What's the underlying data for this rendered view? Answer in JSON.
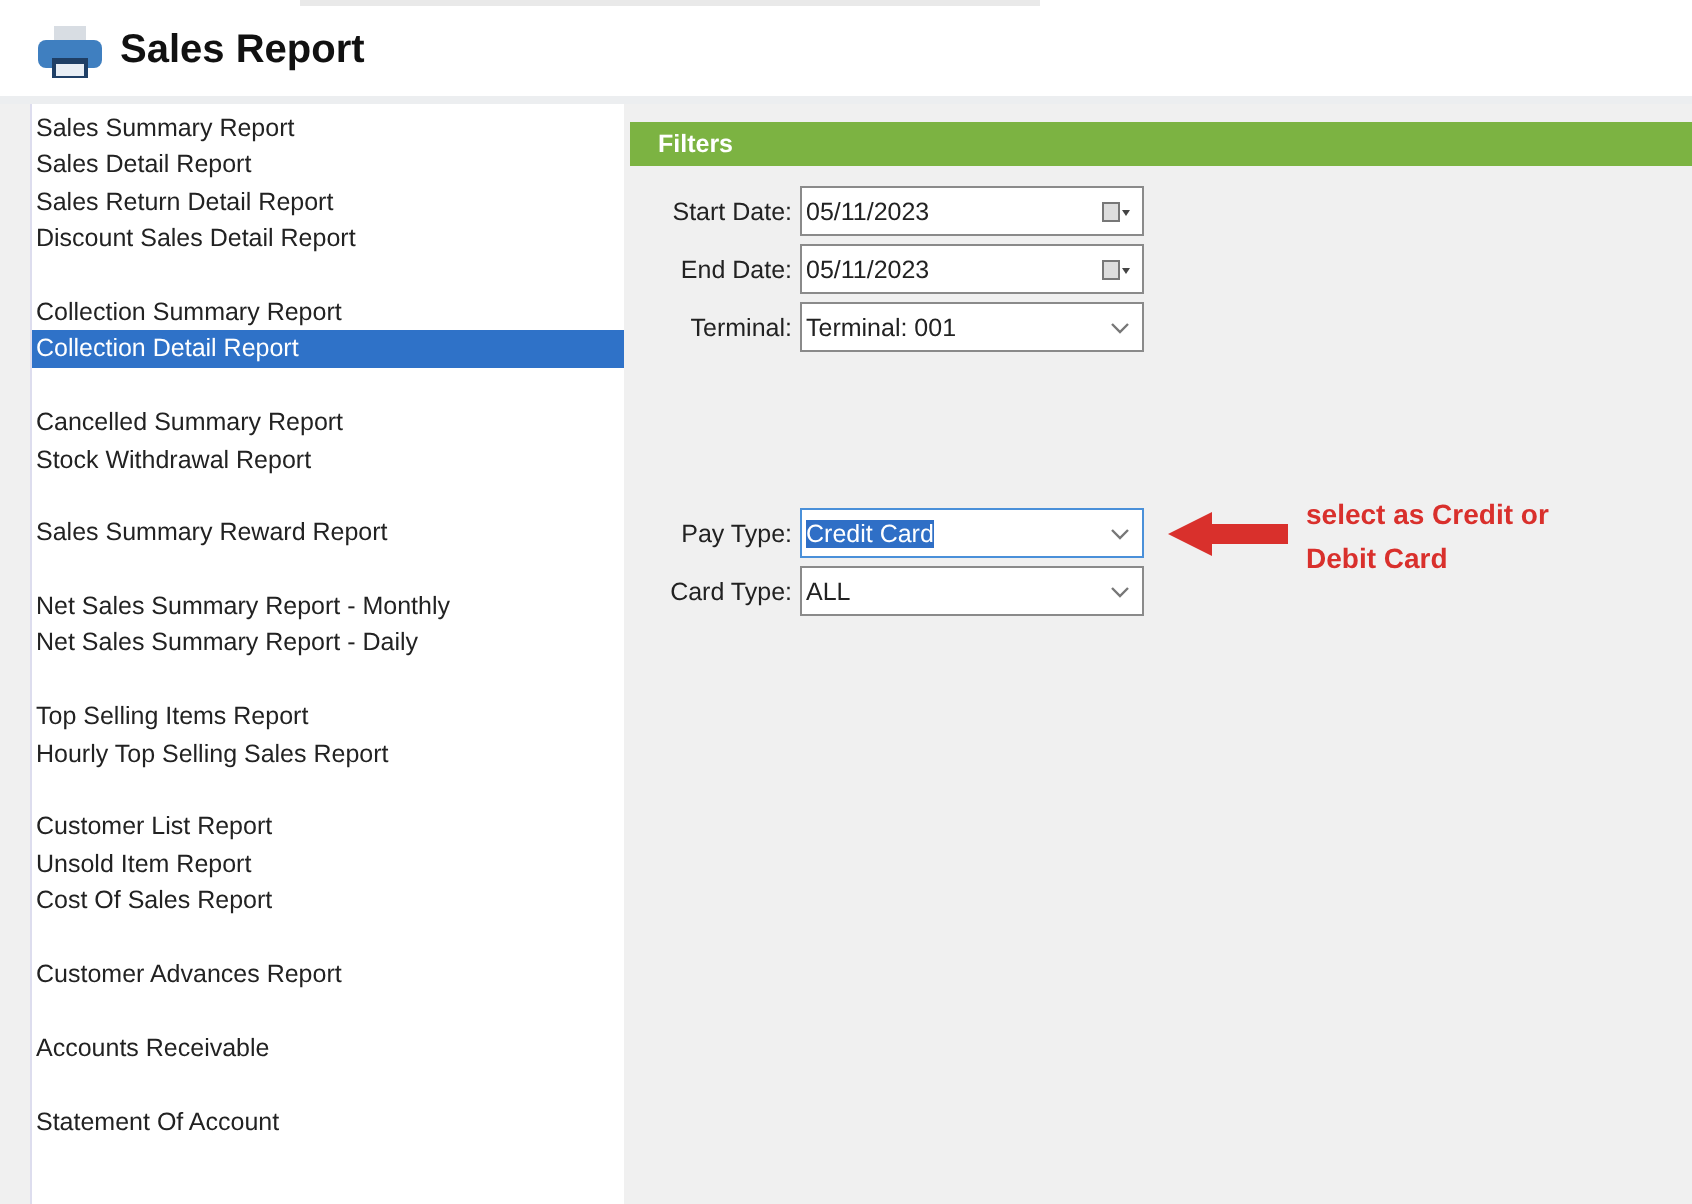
{
  "window": {
    "title": "Sales Report"
  },
  "sidebar": {
    "groups": [
      [
        {
          "label": "Sales Summary Report",
          "selected": false
        },
        {
          "label": "Sales Detail Report",
          "selected": false
        },
        {
          "label": "Sales Return Detail Report",
          "selected": false
        },
        {
          "label": "Discount Sales Detail Report",
          "selected": false
        }
      ],
      [
        {
          "label": "Collection Summary Report",
          "selected": false
        },
        {
          "label": "Collection Detail Report",
          "selected": true
        }
      ],
      [
        {
          "label": "Cancelled Summary Report",
          "selected": false
        },
        {
          "label": "Stock Withdrawal Report",
          "selected": false
        }
      ],
      [
        {
          "label": "Sales Summary Reward Report",
          "selected": false
        }
      ],
      [
        {
          "label": "Net Sales Summary Report - Monthly",
          "selected": false
        },
        {
          "label": "Net Sales Summary Report - Daily",
          "selected": false
        }
      ],
      [
        {
          "label": "Top Selling Items Report",
          "selected": false
        },
        {
          "label": "Hourly Top Selling Sales Report",
          "selected": false
        }
      ],
      [
        {
          "label": "Customer List Report",
          "selected": false
        },
        {
          "label": "Unsold Item Report",
          "selected": false
        },
        {
          "label": "Cost Of Sales Report",
          "selected": false
        }
      ],
      [
        {
          "label": "Customer Advances Report",
          "selected": false
        }
      ],
      [
        {
          "label": "Accounts Receivable",
          "selected": false
        }
      ],
      [
        {
          "label": "Statement Of Account",
          "selected": false
        }
      ]
    ]
  },
  "filters": {
    "title": "Filters",
    "groups": [
      [
        {
          "label": "Start Date:",
          "value": "05/11/2023",
          "kind": "date",
          "highlighted": false
        },
        {
          "label": "End Date:",
          "value": "05/11/2023",
          "kind": "date",
          "highlighted": false
        },
        {
          "label": "Terminal:",
          "value": "Terminal: 001",
          "kind": "dropdown",
          "highlighted": false
        }
      ],
      [
        {
          "label": "Pay Type:",
          "value": "Credit Card",
          "kind": "dropdown",
          "highlighted": true
        },
        {
          "label": "Card Type:",
          "value": "ALL",
          "kind": "dropdown",
          "highlighted": false
        }
      ]
    ]
  },
  "annotation": {
    "text": "select as Credit or Debit Card"
  }
}
